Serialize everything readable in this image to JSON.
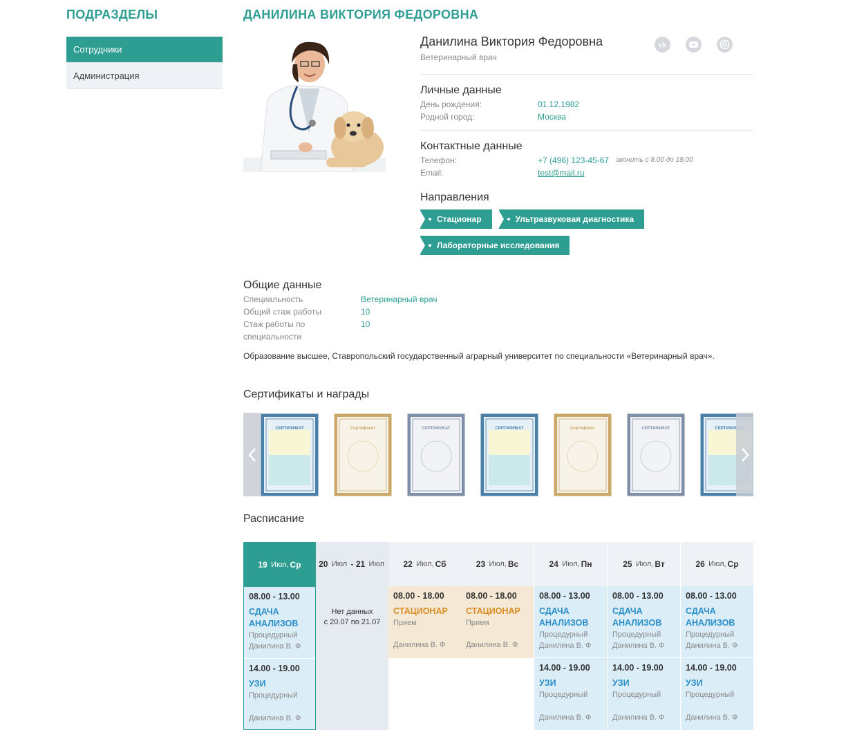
{
  "sidebar": {
    "title": "ПОДРАЗДЕЛЫ",
    "items": [
      {
        "label": "Сотрудники",
        "active": true
      },
      {
        "label": "Администрация",
        "active": false
      }
    ]
  },
  "page": {
    "title": "ДАНИЛИНА ВИКТОРИЯ ФЕДОРОВНА"
  },
  "profile": {
    "name": "Данилина Виктория Федоровна",
    "position": "Ветеринарный врач",
    "social": [
      "vk-icon",
      "youtube-icon",
      "instagram-icon"
    ],
    "personal": {
      "title": "Личные данные",
      "birthday_label": "День рождения:",
      "birthday": "01.12.1982",
      "city_label": "Родной город:",
      "city": "Москва"
    },
    "contacts": {
      "title": "Контактные данные",
      "phone_label": "Телефон:",
      "phone": "+7 (496) 123-45-67",
      "phone_note": "звонить с 8.00 до 18.00",
      "email_label": "Email:",
      "email": "test@mail.ru"
    },
    "directions": {
      "title": "Направления",
      "tags": [
        "Стационар",
        "Ультразвуковая диагностика",
        "Лабораторные исследования"
      ]
    }
  },
  "general": {
    "title": "Общие данные",
    "specialty_label": "Специальность",
    "specialty": "Ветеринарный врач",
    "experience_label": "Общий стаж работы",
    "experience": "10",
    "spec_experience_label_1": "Стаж работы по",
    "spec_experience_label_2": "специальности",
    "spec_experience": "10",
    "education": "Образование высшее, Ставропольский государственный аграрный университет по специальности «Ветеринарный врач»."
  },
  "certificates": {
    "title": "Сертификаты и награды",
    "items": [
      {
        "type": "blue",
        "label": "СЕРТИФИКАТ"
      },
      {
        "type": "gold",
        "label": "Сертификат"
      },
      {
        "type": "grey",
        "label": "СЕРТИФИКАТ"
      },
      {
        "type": "blue",
        "label": "СЕРТИФИКАТ"
      },
      {
        "type": "gold",
        "label": "Сертификат"
      },
      {
        "type": "grey",
        "label": "СЕРТИФИКАТ"
      },
      {
        "type": "blue",
        "label": "СЕРТИФИКАТ"
      }
    ],
    "colors": {
      "blue": "#4a7fa8",
      "gold": "#c9a86a",
      "grey": "#7d8ea6"
    }
  },
  "schedule": {
    "title": "Расписание",
    "columns": [
      {
        "day": "19",
        "month": "Июл,",
        "weekday": "Ср",
        "today": true
      },
      {
        "day": "20",
        "month": "Июл",
        "day2": "21",
        "month2": "Июл",
        "range": true
      },
      {
        "day": "22",
        "month": "Июл,",
        "weekday": "Сб"
      },
      {
        "day": "23",
        "month": "Июл,",
        "weekday": "Вс"
      },
      {
        "day": "24",
        "month": "Июл,",
        "weekday": "Пн"
      },
      {
        "day": "25",
        "month": "Июл,",
        "weekday": "Вт"
      },
      {
        "day": "26",
        "month": "Июл,",
        "weekday": "Ср"
      }
    ],
    "nodata": {
      "line1": "Нет данных",
      "line2": "с 20.07 по 21.07"
    },
    "slot_analysis": {
      "time": "08.00 - 13.00",
      "service_1": "СДАЧА",
      "service_2": "АНАЛИЗОВ",
      "room": "Процедурный",
      "doctor": "Данилина В. Ф"
    },
    "slot_uzi": {
      "time": "14.00 - 19.00",
      "service": "УЗИ",
      "room": "Процедурный",
      "doctor": "Данилина В. Ф"
    },
    "slot_stationary": {
      "time": "08.00 - 18.00",
      "service": "СТАЦИОНАР",
      "room": "Прием",
      "doctor": "Данилина В. Ф"
    },
    "colors": {
      "accent": "#2e9e93",
      "blue": "#dbeef8",
      "orange": "#f5e9d6"
    }
  }
}
